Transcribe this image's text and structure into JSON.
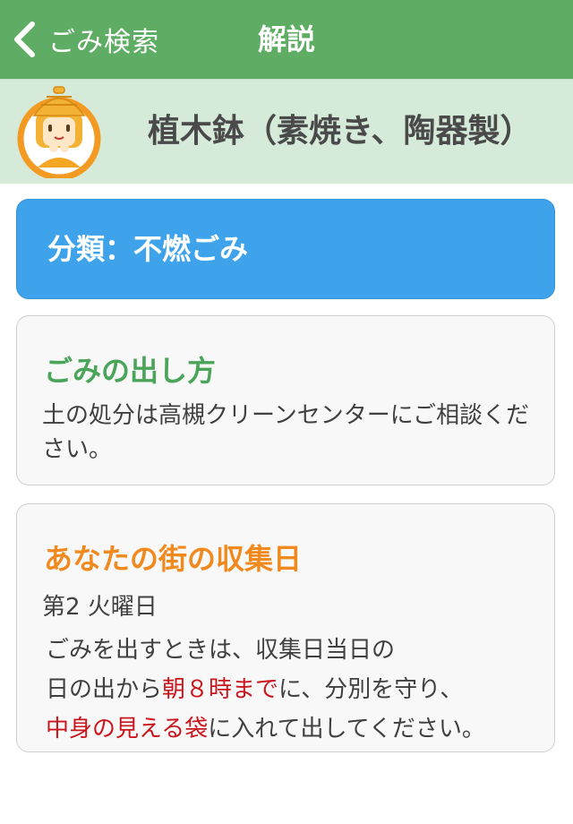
{
  "nav": {
    "back_label": "ごみ検索",
    "title": "解説"
  },
  "header": {
    "item_name": "植木鉢（素焼き、陶器製）"
  },
  "category": {
    "label": "分類：不燃ごみ"
  },
  "disposal": {
    "title": "ごみの出し方",
    "body": "土の処分は高槻クリーンセンターにご相談ください。"
  },
  "collection": {
    "title": "あなたの街の収集日",
    "schedule": "第2 火曜日",
    "line1": "ごみを出すときは、収集日当日の",
    "line2_a": "日の出から",
    "line2_b": "朝８時まで",
    "line2_c": "に、分別を守り、",
    "line3_a": "中身の見える袋",
    "line3_b": "に入れて出してください。"
  },
  "colors": {
    "nav_green": "#5fad65",
    "header_green": "#d5ead8",
    "category_blue": "#3fa3ec",
    "title_green": "#4aa55a",
    "title_orange": "#f08a1e",
    "emphasis_red": "#c9161d"
  }
}
